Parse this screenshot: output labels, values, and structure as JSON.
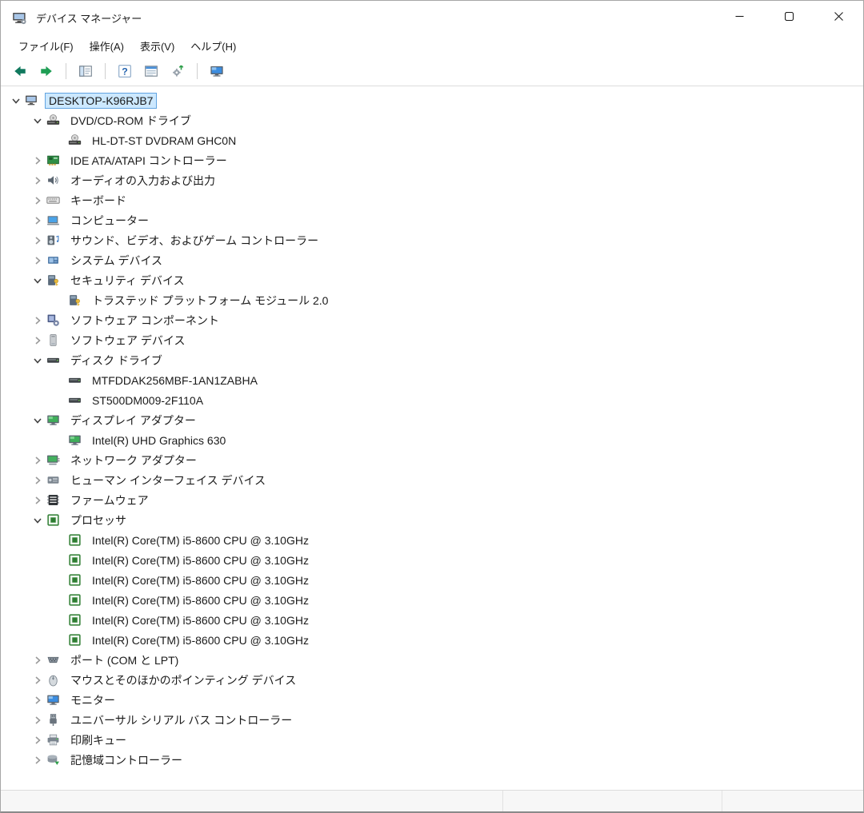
{
  "window": {
    "title": "デバイス マネージャー"
  },
  "menu": {
    "items": [
      {
        "name": "file",
        "label": "ファイル(F)"
      },
      {
        "name": "action",
        "label": "操作(A)"
      },
      {
        "name": "view",
        "label": "表示(V)"
      },
      {
        "name": "help",
        "label": "ヘルプ(H)"
      }
    ]
  },
  "toolbar": {
    "buttons": [
      {
        "name": "back",
        "icon": "back-icon"
      },
      {
        "name": "forward",
        "icon": "forward-icon"
      },
      {
        "name": "separator"
      },
      {
        "name": "show-console-tree",
        "icon": "console-tree-icon"
      },
      {
        "name": "separator"
      },
      {
        "name": "help",
        "icon": "help-icon"
      },
      {
        "name": "properties",
        "icon": "properties-icon"
      },
      {
        "name": "scan-hardware-changes",
        "icon": "scan-hardware-icon"
      },
      {
        "name": "separator"
      },
      {
        "name": "device-view",
        "icon": "monitor-view-icon"
      }
    ]
  },
  "tree": {
    "items": [
      {
        "level": 0,
        "state": "expanded",
        "icon": "computer-icon",
        "label": "DESKTOP-K96RJB7",
        "selected": true
      },
      {
        "level": 1,
        "state": "expanded",
        "icon": "dvd-rom-icon",
        "label": "DVD/CD-ROM ドライブ"
      },
      {
        "level": 2,
        "state": "leaf",
        "icon": "dvd-rom-icon",
        "label": "HL-DT-ST DVDRAM GHC0N"
      },
      {
        "level": 1,
        "state": "collapsed",
        "icon": "ide-controller-icon",
        "label": "IDE ATA/ATAPI コントローラー"
      },
      {
        "level": 1,
        "state": "collapsed",
        "icon": "audio-io-icon",
        "label": "オーディオの入力および出力"
      },
      {
        "level": 1,
        "state": "collapsed",
        "icon": "keyboard-icon",
        "label": "キーボード"
      },
      {
        "level": 1,
        "state": "collapsed",
        "icon": "computer-device-icon",
        "label": "コンピューター"
      },
      {
        "level": 1,
        "state": "collapsed",
        "icon": "sound-controller-icon",
        "label": "サウンド、ビデオ、およびゲーム コントローラー"
      },
      {
        "level": 1,
        "state": "collapsed",
        "icon": "system-device-icon",
        "label": "システム デバイス"
      },
      {
        "level": 1,
        "state": "expanded",
        "icon": "security-device-icon",
        "label": "セキュリティ デバイス"
      },
      {
        "level": 2,
        "state": "leaf",
        "icon": "security-device-icon",
        "label": "トラステッド プラットフォーム モジュール 2.0"
      },
      {
        "level": 1,
        "state": "collapsed",
        "icon": "software-component-icon",
        "label": "ソフトウェア コンポーネント"
      },
      {
        "level": 1,
        "state": "collapsed",
        "icon": "software-device-icon",
        "label": "ソフトウェア デバイス"
      },
      {
        "level": 1,
        "state": "expanded",
        "icon": "disk-drive-icon",
        "label": "ディスク ドライブ"
      },
      {
        "level": 2,
        "state": "leaf",
        "icon": "disk-drive-icon",
        "label": "MTFDDAK256MBF-1AN1ZABHA"
      },
      {
        "level": 2,
        "state": "leaf",
        "icon": "disk-drive-icon",
        "label": "ST500DM009-2F110A"
      },
      {
        "level": 1,
        "state": "expanded",
        "icon": "display-adapter-icon",
        "label": "ディスプレイ アダプター"
      },
      {
        "level": 2,
        "state": "leaf",
        "icon": "display-adapter-icon",
        "label": "Intel(R) UHD Graphics 630"
      },
      {
        "level": 1,
        "state": "collapsed",
        "icon": "network-adapter-icon",
        "label": "ネットワーク アダプター"
      },
      {
        "level": 1,
        "state": "collapsed",
        "icon": "hid-icon",
        "label": "ヒューマン インターフェイス デバイス"
      },
      {
        "level": 1,
        "state": "collapsed",
        "icon": "firmware-icon",
        "label": "ファームウェア"
      },
      {
        "level": 1,
        "state": "expanded",
        "icon": "processor-icon",
        "label": "プロセッサ"
      },
      {
        "level": 2,
        "state": "leaf",
        "icon": "processor-icon",
        "label": "Intel(R) Core(TM) i5-8600 CPU @ 3.10GHz"
      },
      {
        "level": 2,
        "state": "leaf",
        "icon": "processor-icon",
        "label": "Intel(R) Core(TM) i5-8600 CPU @ 3.10GHz"
      },
      {
        "level": 2,
        "state": "leaf",
        "icon": "processor-icon",
        "label": "Intel(R) Core(TM) i5-8600 CPU @ 3.10GHz"
      },
      {
        "level": 2,
        "state": "leaf",
        "icon": "processor-icon",
        "label": "Intel(R) Core(TM) i5-8600 CPU @ 3.10GHz"
      },
      {
        "level": 2,
        "state": "leaf",
        "icon": "processor-icon",
        "label": "Intel(R) Core(TM) i5-8600 CPU @ 3.10GHz"
      },
      {
        "level": 2,
        "state": "leaf",
        "icon": "processor-icon",
        "label": "Intel(R) Core(TM) i5-8600 CPU @ 3.10GHz"
      },
      {
        "level": 1,
        "state": "collapsed",
        "icon": "ports-icon",
        "label": "ポート (COM と LPT)"
      },
      {
        "level": 1,
        "state": "collapsed",
        "icon": "mouse-icon",
        "label": "マウスとそのほかのポインティング デバイス"
      },
      {
        "level": 1,
        "state": "collapsed",
        "icon": "monitor-icon",
        "label": "モニター"
      },
      {
        "level": 1,
        "state": "collapsed",
        "icon": "usb-icon",
        "label": "ユニバーサル シリアル バス コントローラー"
      },
      {
        "level": 1,
        "state": "collapsed",
        "icon": "print-queue-icon",
        "label": "印刷キュー"
      },
      {
        "level": 1,
        "state": "collapsed",
        "icon": "storage-controller-icon",
        "label": "記憶域コントローラー"
      }
    ]
  },
  "statusbar": {
    "sections": [
      "",
      "",
      ""
    ]
  },
  "colors": {
    "selection_bg": "#cce8ff",
    "selection_border": "#62a4e0",
    "back_arrow_green": "#11795e",
    "forward_arrow_green": "#1e9e54"
  }
}
